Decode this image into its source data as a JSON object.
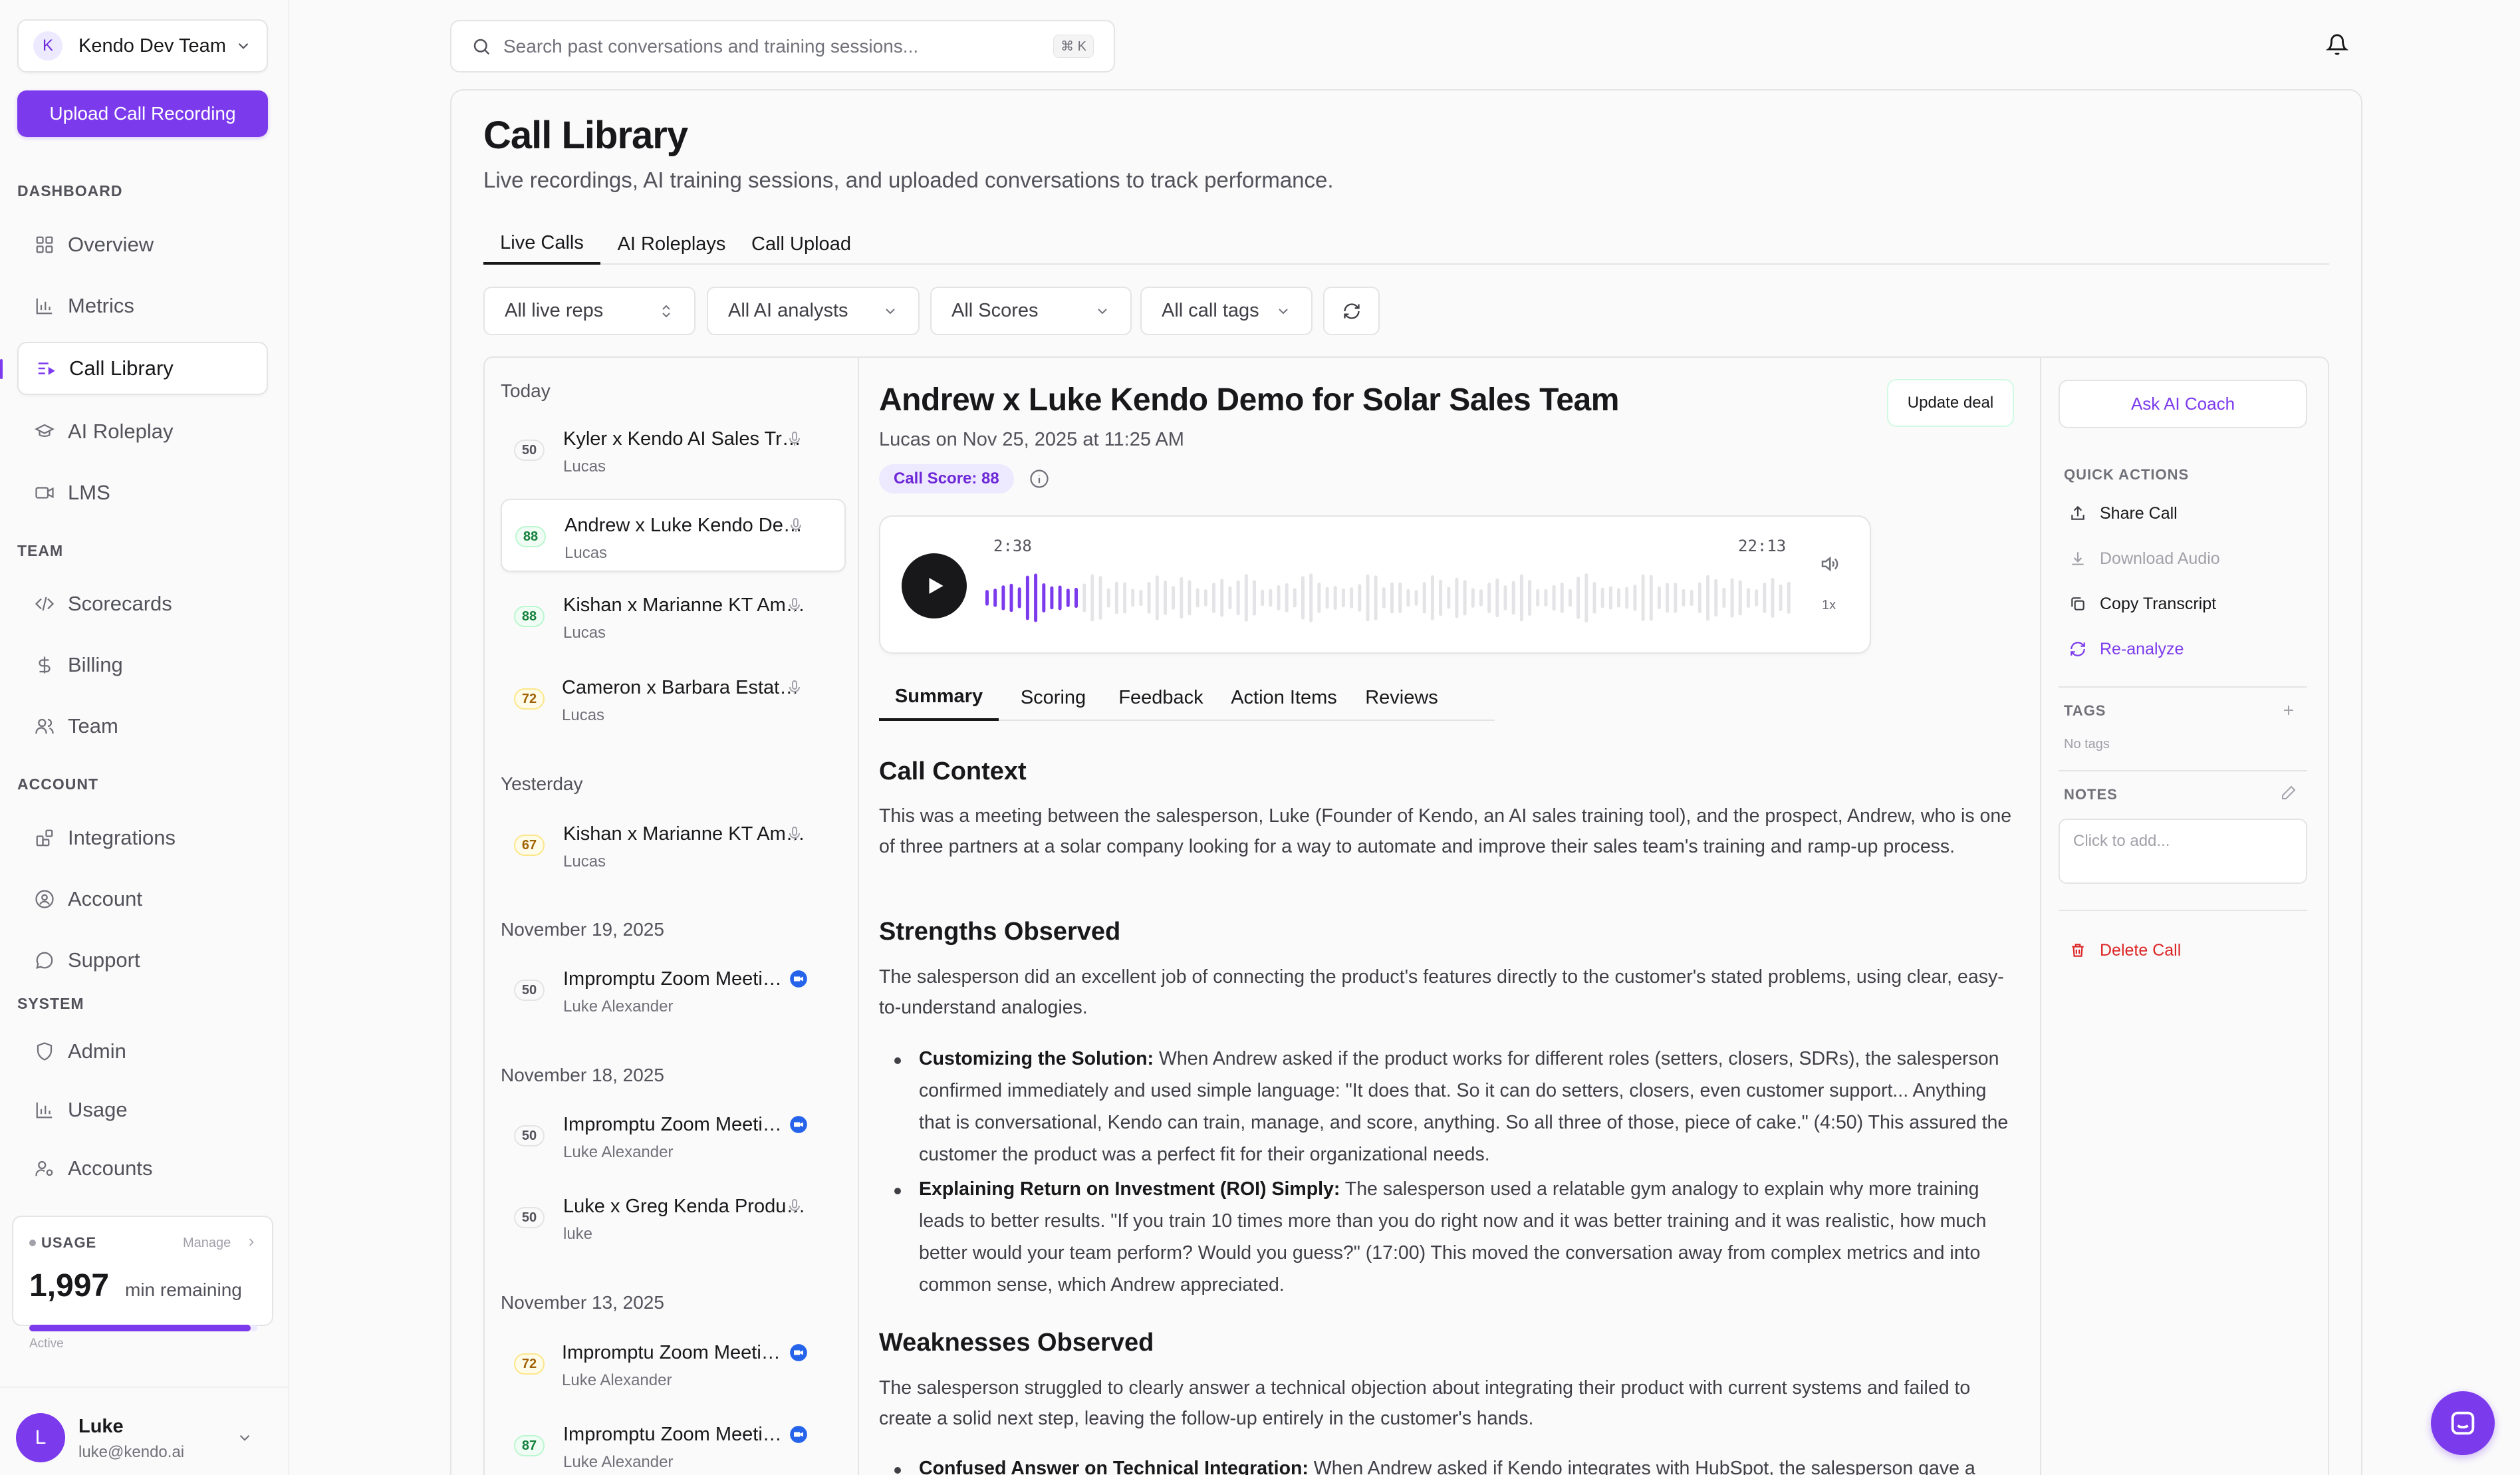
{
  "sidebar": {
    "team": {
      "avatar": "K",
      "name": "Kendo Dev Team"
    },
    "upload_label": "Upload Call Recording",
    "sections": {
      "dashboard": "DASHBOARD",
      "team": "TEAM",
      "account": "ACCOUNT",
      "system": "SYSTEM"
    },
    "items": {
      "overview": "Overview",
      "metrics": "Metrics",
      "call_library": "Call Library",
      "ai_roleplay": "AI Roleplay",
      "lms": "LMS",
      "scorecards": "Scorecards",
      "billing": "Billing",
      "team": "Team",
      "integrations": "Integrations",
      "account": "Account",
      "support": "Support",
      "admin": "Admin",
      "usage": "Usage",
      "accounts": "Accounts"
    },
    "usage": {
      "label": "USAGE",
      "manage": "Manage",
      "minutes": "1,997",
      "unit": "min remaining",
      "status": "Active",
      "fill_fraction": 0.97
    },
    "user": {
      "initial": "L",
      "name": "Luke",
      "email": "luke@kendo.ai"
    }
  },
  "search": {
    "placeholder": "Search past conversations and training sessions...",
    "shortcut": "⌘ K"
  },
  "page": {
    "title": "Call Library",
    "subtitle": "Live recordings, AI training sessions, and uploaded conversations to track performance.",
    "tabs": [
      "Live Calls",
      "AI Roleplays",
      "Call Upload"
    ]
  },
  "filters": {
    "reps": "All live reps",
    "analysts": "All AI analysts",
    "scores": "All Scores",
    "tags": "All call tags"
  },
  "call_list": {
    "groups": [
      "Today",
      "Yesterday",
      "November 19, 2025",
      "November 18, 2025",
      "November 13, 2025"
    ],
    "calls": [
      {
        "score": "50",
        "title": "Kyler x Kendo AI Sales Training",
        "owner": "Lucas"
      },
      {
        "score": "88",
        "title": "Andrew x Luke Kendo Demo for Solar Sales Team",
        "owner": "Lucas"
      },
      {
        "score": "88",
        "title": "Kishan x Marianne KT Amazon",
        "owner": "Lucas"
      },
      {
        "score": "72",
        "title": "Cameron x Barbara Estate Planning",
        "owner": "Lucas"
      },
      {
        "score": "67",
        "title": "Kishan x Marianne KT Amazon",
        "owner": "Lucas"
      },
      {
        "score": "50",
        "title": "Impromptu Zoom Meeting",
        "owner": "Luke Alexander"
      },
      {
        "score": "50",
        "title": "Impromptu Zoom Meeting",
        "owner": "Luke Alexander"
      },
      {
        "score": "50",
        "title": "Luke x Greg Kenda Product Demo",
        "owner": "luke"
      },
      {
        "score": "72",
        "title": "Impromptu Zoom Meeting",
        "owner": "Luke Alexander"
      },
      {
        "score": "87",
        "title": "Impromptu Zoom Meeting",
        "owner": "Luke Alexander"
      }
    ]
  },
  "detail": {
    "title": "Andrew x Luke Kendo Demo for Solar Sales Team",
    "meta": "Lucas on Nov 25, 2025 at 11:25 AM",
    "score_tag": "Call Score: 88",
    "update_deal": "Update deal",
    "player": {
      "current": "2:38",
      "duration": "22:13",
      "speed": "1x",
      "progress_fraction": 0.119
    },
    "tabs": [
      "Summary",
      "Scoring",
      "Feedback",
      "Action Items",
      "Reviews"
    ],
    "summary": {
      "h_context": "Call Context",
      "context": "This was a meeting between the salesperson, Luke (Founder of Kendo, an AI sales training tool), and the prospect, Andrew, who is one of three partners at a solar company looking for a way to automate and improve their sales team's training and ramp-up process.",
      "h_strengths": "Strengths Observed",
      "strengths_intro": "The salesperson did an excellent job of connecting the product's features directly to the customer's stated problems, using clear, easy-to-understand analogies.",
      "strength1_title": "Customizing the Solution:",
      "strength1_text": " When Andrew asked if the product works for different roles (setters, closers, SDRs), the salesperson confirmed immediately and used simple language: \"It does that. So it can do setters, closers, even customer support... Anything that is conversational, Kendo can train, manage, and score, anything. So all three of those, piece of cake.\" (4:50) This assured the customer the product was a perfect fit for their organizational needs.",
      "strength2_title": "Explaining Return on Investment (ROI) Simply:",
      "strength2_text": " The salesperson used a relatable gym analogy to explain why more training leads to better results. \"If you train 10 times more than you do right now and it was better training and it was realistic, how much better would your team perform? Would you guess?\" (17:00) This moved the conversation away from complex metrics and into common sense, which Andrew appreciated.",
      "h_weaknesses": "Weaknesses Observed",
      "weaknesses_intro": "The salesperson struggled to clearly answer a technical objection about integrating their product with current systems and failed to create a solid next step, leaving the follow-up entirely in the customer's hands.",
      "weakness1_title": "Confused Answer on Technical Integration:",
      "weakness1_text": " When Andrew asked if Kendo integrates with HubSpot, the salesperson gave a"
    }
  },
  "right_panel": {
    "ask_coach": "Ask AI Coach",
    "quick_actions_label": "QUICK ACTIONS",
    "share": "Share Call",
    "download": "Download Audio",
    "copy": "Copy Transcript",
    "reanalyze": "Re-analyze",
    "tags_label": "TAGS",
    "no_tags": "No tags",
    "notes_label": "NOTES",
    "notes_placeholder": "Click to add...",
    "delete": "Delete Call"
  },
  "colors": {
    "accent": "#7c3aed",
    "danger": "#dc2626",
    "score_green": "#15803d",
    "score_yellow": "#a16207"
  }
}
